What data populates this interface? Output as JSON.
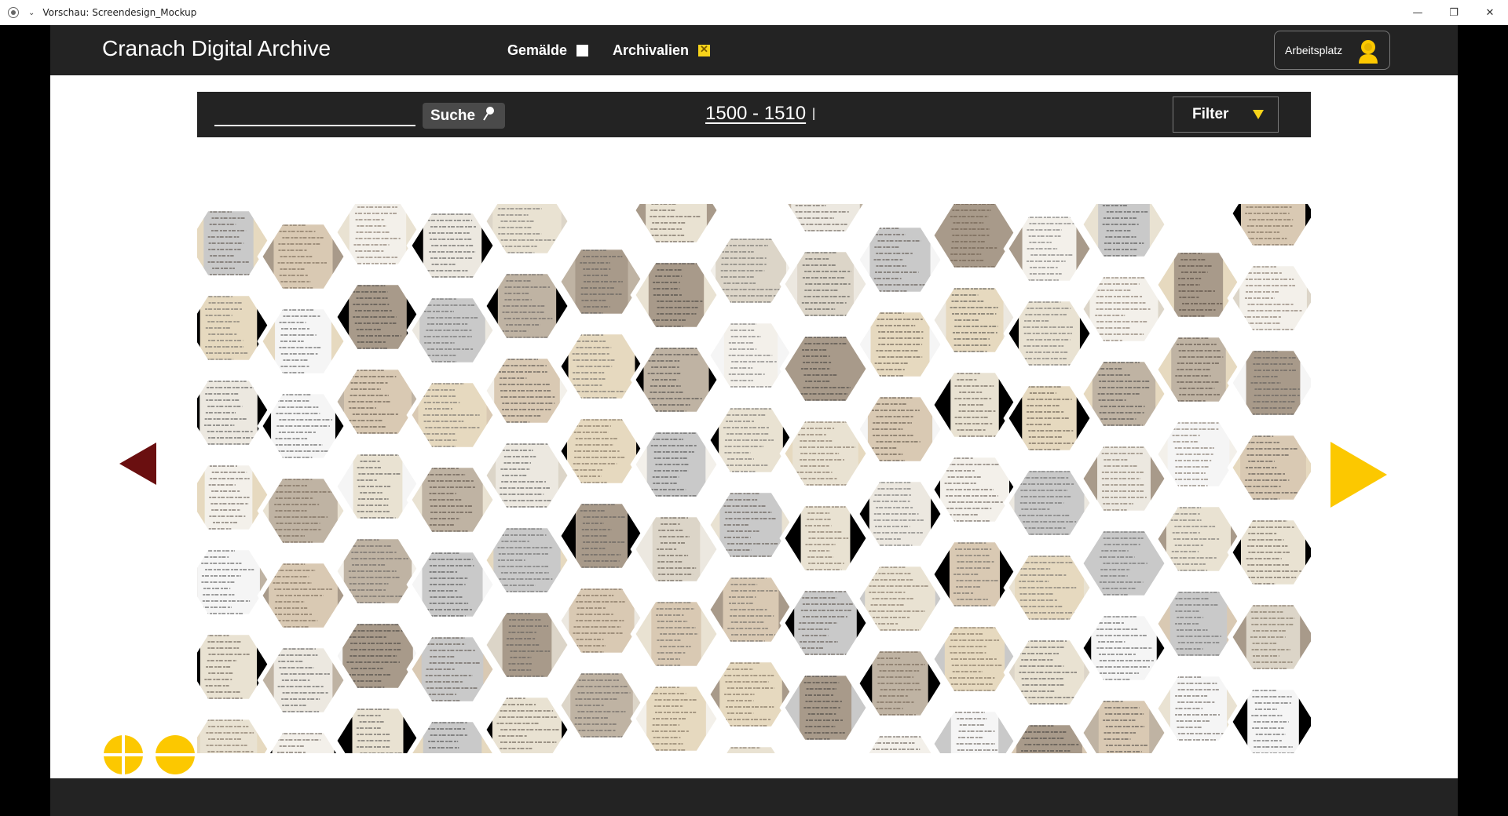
{
  "window": {
    "title": "Vorschau: Screendesign_Mockup",
    "controls": [
      "—",
      "❐",
      "✕"
    ]
  },
  "header": {
    "brand": "Cranach Digital Archive",
    "toggles": [
      {
        "label": "Gemälde",
        "checked": false
      },
      {
        "label": "Archivalien",
        "checked": true
      }
    ],
    "workspace_label": "Arbeitsplatz"
  },
  "search": {
    "value": "",
    "button_label": "Suche",
    "date_range": "1500 - 1510",
    "filter_label": "Filter"
  },
  "colors": {
    "accent": "#fcc800",
    "prev_arrow": "#6a0f10",
    "dark": "#232323"
  },
  "gallery": {
    "tile_count": 60
  }
}
